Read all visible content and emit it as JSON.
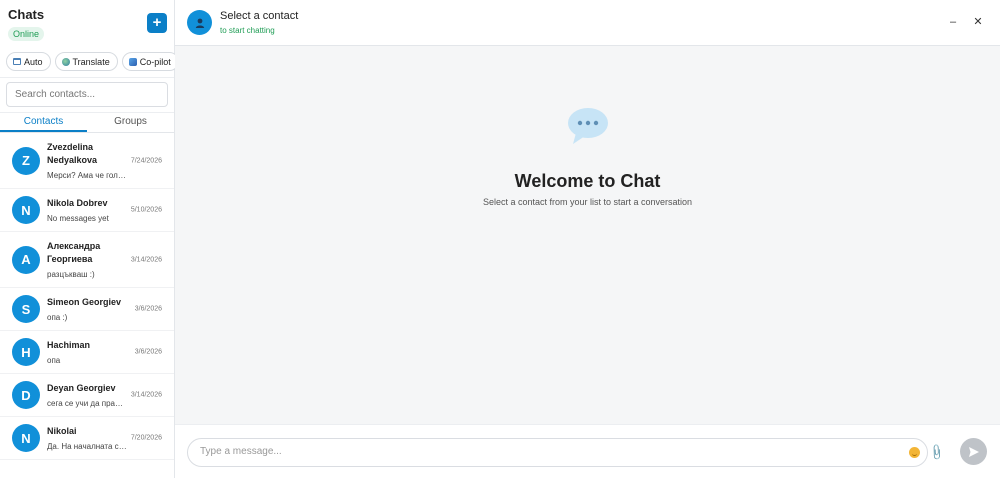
{
  "sidebar": {
    "title": "Chats",
    "status": "Online",
    "new_chat_label": "+",
    "pills": [
      {
        "label": "Auto",
        "icon": "building-icon"
      },
      {
        "label": "Translate",
        "icon": "globe-icon"
      },
      {
        "label": "Co-pilot",
        "icon": "copilot-icon"
      }
    ],
    "search_placeholder": "Search contacts...",
    "tabs": [
      "Contacts",
      "Groups"
    ],
    "active_tab": "Contacts",
    "contacts": [
      {
        "initial": "Z",
        "name": "Zvezdelina Nedyalkova",
        "last": "Мерси? Ама че голя...",
        "date": "7/24/2026"
      },
      {
        "initial": "N",
        "name": "Nikola Dobrev",
        "last": "No messages yet",
        "date": "5/10/2026"
      },
      {
        "initial": "A",
        "name": "Александра Георгиева",
        "last": "разцъкваш :)",
        "date": "3/14/2026"
      },
      {
        "initial": "S",
        "name": "Simeon Georgiev",
        "last": "опа :)",
        "date": "3/6/2026"
      },
      {
        "initial": "H",
        "name": "Hachiman",
        "last": "опа",
        "date": "3/6/2026"
      },
      {
        "initial": "D",
        "name": "Deyan Georgiev",
        "last": "сега се учи да прави...",
        "date": "3/14/2026"
      },
      {
        "initial": "N",
        "name": "Nikolai",
        "last": "Да. На началната ст...",
        "date": "7/20/2026"
      }
    ]
  },
  "header": {
    "title": "Select a contact",
    "subtitle": "to start chatting",
    "minimize_label": "–",
    "close_label": "✕"
  },
  "main": {
    "welcome_title": "Welcome to Chat",
    "welcome_subtitle": "Select a contact from your list to start a conversation"
  },
  "composer": {
    "placeholder": "Type a message..."
  },
  "colors": {
    "accent": "#0b7fc7",
    "avatar": "#1190d9",
    "online": "#1f9d55",
    "send_disabled": "#bfc3c8"
  }
}
